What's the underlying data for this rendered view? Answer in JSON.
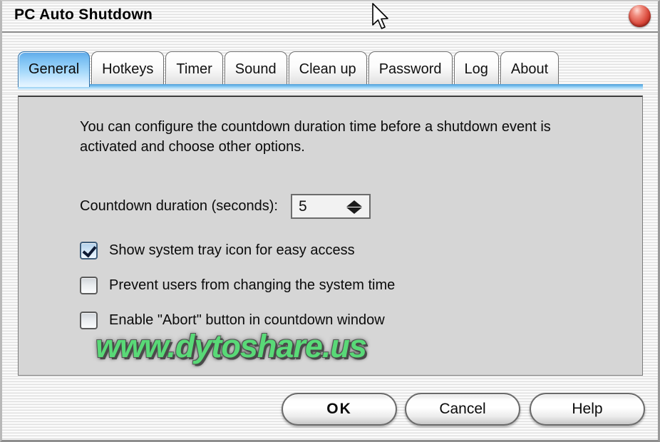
{
  "window": {
    "title": "PC Auto Shutdown",
    "close_button_label": "",
    "close_icon": "close-round-red-icon"
  },
  "tabs": {
    "active": "General",
    "items": [
      {
        "label": "General"
      },
      {
        "label": "Hotkeys"
      },
      {
        "label": "Timer"
      },
      {
        "label": "Sound"
      },
      {
        "label": "Clean up"
      },
      {
        "label": "Password"
      },
      {
        "label": "Log"
      },
      {
        "label": "About"
      }
    ]
  },
  "general": {
    "intro": "You can configure the countdown duration time before a shutdown event is activated and choose other options.",
    "duration_label": "Countdown duration (seconds):",
    "duration_value": "5",
    "spinner_up_icon": "spinner-up-arrow-icon",
    "spinner_down_icon": "spinner-down-arrow-icon",
    "checkboxes": [
      {
        "label": "Show system tray icon for easy access",
        "checked": true
      },
      {
        "label": "Prevent users from changing the system time",
        "checked": false
      },
      {
        "label": "Enable \"Abort\" button in countdown window",
        "checked": false
      }
    ],
    "watermark": "www.dytoshare.us"
  },
  "footer": {
    "ok_label": "OK",
    "cancel_label": "Cancel",
    "help_label": "Help"
  },
  "colors": {
    "accent_blue": "#5fa9e8",
    "tab_underline": "#4f9ed8",
    "close_red": "#d9483a",
    "watermark_green": "#59d977",
    "panel_bg": "#d6d6d6"
  },
  "cursor": {
    "icon": "mouse-pointer-arrow-icon"
  }
}
